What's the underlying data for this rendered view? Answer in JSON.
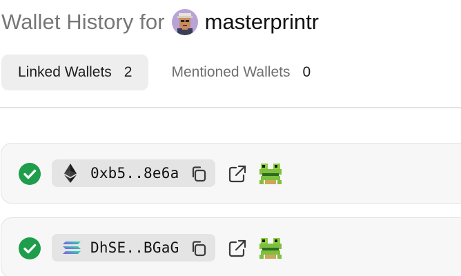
{
  "header": {
    "prefix": "Wallet History for",
    "username": "masterprintr",
    "avatar_icon": "pixel-punk-avatar"
  },
  "tabs": [
    {
      "label": "Linked Wallets",
      "count": "2",
      "active": true
    },
    {
      "label": "Mentioned Wallets",
      "count": "0",
      "active": false
    }
  ],
  "wallets": [
    {
      "chain": "ethereum",
      "chain_icon": "ethereum-icon",
      "address": "0xb5..8e6a",
      "verified": true
    },
    {
      "chain": "solana",
      "chain_icon": "solana-icon",
      "address": "DhSE..BGaG",
      "verified": true
    }
  ],
  "colors": {
    "verified_green": "#1e9e4a",
    "pill_bg": "#e4e4e4",
    "card_bg": "#f7f7f7",
    "frog_green": "#7fbf3f"
  },
  "icons": {
    "copy": "copy-icon",
    "external_link": "external-link-icon",
    "frog": "frog-icon",
    "check": "check-circle-icon"
  }
}
